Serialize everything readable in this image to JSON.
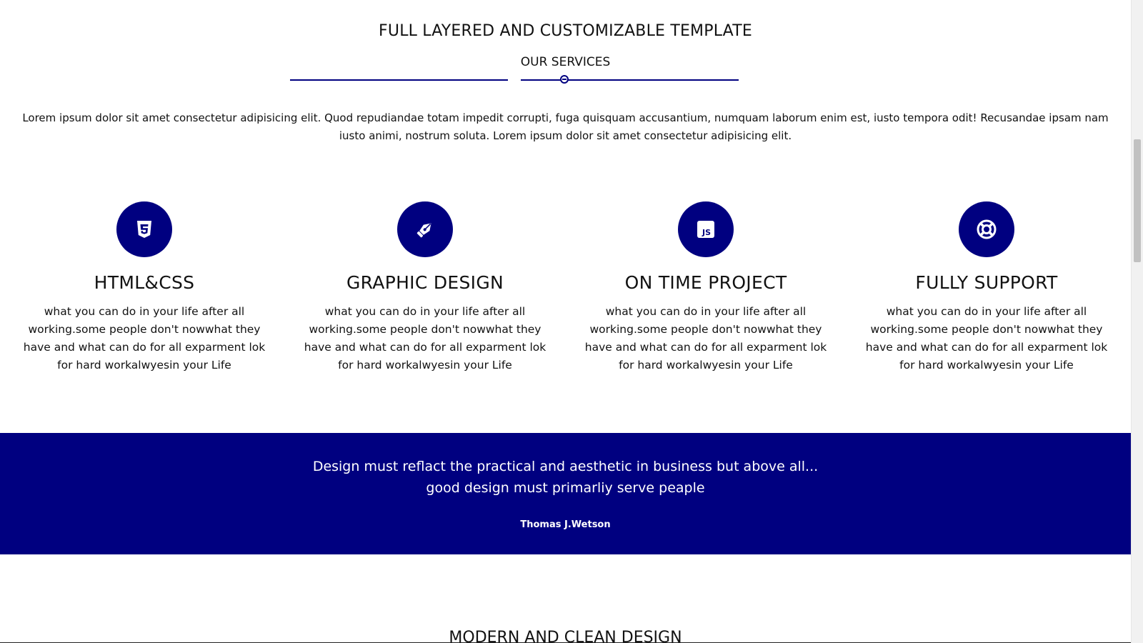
{
  "header": {
    "title": "FULL LAYERED AND CUSTOMIZABLE TEMPLATE",
    "subtitle": "OUR SERVICES"
  },
  "intro": {
    "text": "Lorem ipsum dolor sit amet consectetur adipisicing elit. Quod repudiandae totam impedit corrupti, fuga quisquam accusantium, numquam laborum enim est, iusto tempora odit! Recusandae ipsam nam iusto animi, nostrum soluta. Lorem ipsum dolor sit amet consectetur adipisicing elit."
  },
  "services": [
    {
      "icon": "css3-icon",
      "title": "HTML&CSS",
      "description": "what you can do in your life after all working.some people don't nowwhat they have and what can do for all exparment lok for hard workalwyesin your Life"
    },
    {
      "icon": "pen-nib-icon",
      "title": "GRAPHIC DESIGN",
      "description": "what you can do in your life after all working.some people don't nowwhat they have and what can do for all exparment lok for hard workalwyesin your Life"
    },
    {
      "icon": "js-icon",
      "title": "ON TIME PROJECT",
      "description": "what you can do in your life after all working.some people don't nowwhat they have and what can do for all exparment lok for hard workalwyesin your Life"
    },
    {
      "icon": "life-ring-icon",
      "title": "FULLY SUPPORT",
      "description": "what you can do in your life after all working.some people don't nowwhat they have and what can do for all exparment lok for hard workalwyesin your Life"
    }
  ],
  "quote": {
    "line1": "Design must reflact the practical and aesthetic in business but above all...",
    "line2": "good design must primarliy serve peaple",
    "author": "Thomas J.Wetson"
  },
  "next_section": {
    "title": "MODERN AND CLEAN DESIGN"
  },
  "colors": {
    "accent": "#000080",
    "text": "#111111",
    "background": "#ffffff"
  }
}
